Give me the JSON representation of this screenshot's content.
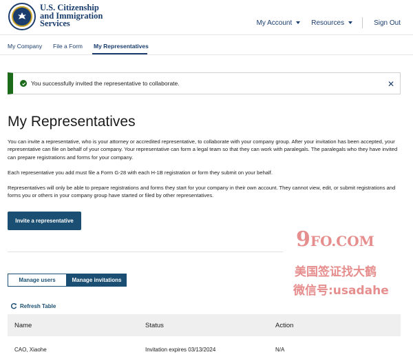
{
  "header": {
    "agency_line1": "U.S. Citizenship",
    "agency_line2": "and Immigration",
    "agency_line3": "Services",
    "nav": {
      "my_account": "My Account",
      "resources": "Resources",
      "sign_out": "Sign Out"
    },
    "brand_color": "#1a3d6d"
  },
  "tabs": [
    {
      "label": "My Company",
      "active": false
    },
    {
      "label": "File a Form",
      "active": false
    },
    {
      "label": "My Representatives",
      "active": true
    }
  ],
  "alert": {
    "message": "You successfully invited the representative to collaborate.",
    "status_color": "#1b6b1b",
    "close_icon": "close-icon"
  },
  "main": {
    "title": "My Representatives",
    "paragraphs": [
      "You can invite a representative, who is your attorney or accredited representative, to collaborate with your company group. After your invitation has been accepted, your representative can file on behalf of your company. Your representative can form a legal team so that they can work with paralegals. The paralegals who they have invited can prepare registrations and forms for your company.",
      "Each representative you add must file a Form G-28 with each H-1B registration or form they submit on your behalf.",
      "Representatives will only be able to prepare registrations and forms they start for your company in their own account. They cannot view, edit, or submit registrations and forms you or others in your company group have started or filed by other representatives."
    ],
    "invite_button": "Invite a representative"
  },
  "watermark": {
    "line1_big": "9",
    "line1_rest": "FO.COM",
    "line2": "美国签证找大鹤",
    "line3": "微信号:usadahe"
  },
  "toggle": {
    "manage_users": "Manage users",
    "manage_invitations": "Manage invitations",
    "selected": "manage_invitations"
  },
  "refresh": {
    "label": "Refresh Table",
    "icon": "refresh-icon"
  },
  "table": {
    "columns": [
      "Name",
      "Status",
      "Action"
    ],
    "rows": [
      {
        "name": "CAO, Xiaohe",
        "status": "Invitation expires 03/13/2024",
        "action": "N/A"
      }
    ]
  }
}
